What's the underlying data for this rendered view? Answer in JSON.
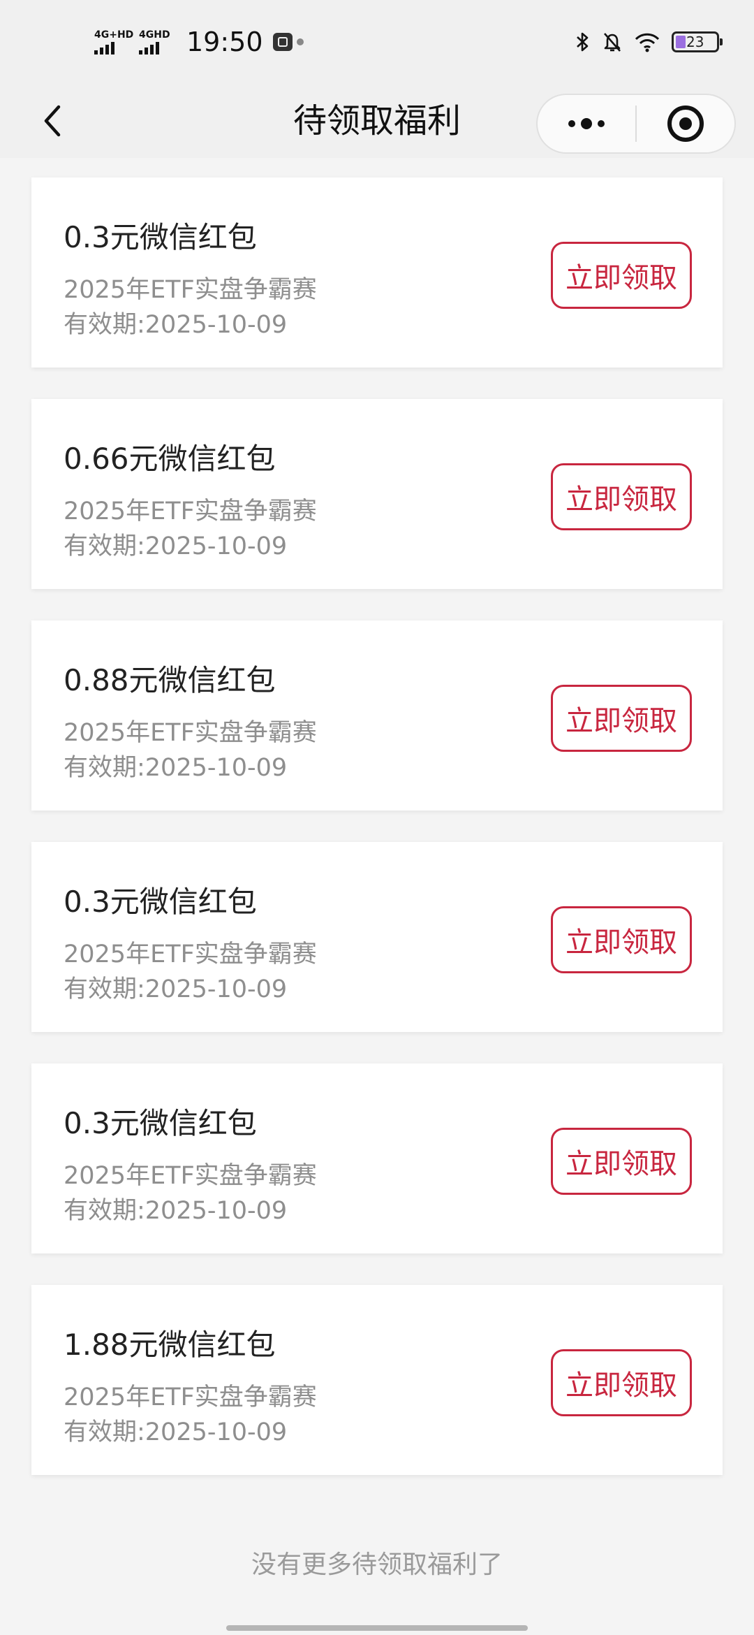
{
  "status_bar": {
    "signal1_tag": "4G+HD",
    "signal2_tag": "4GHD",
    "time": "19:50",
    "battery": "23",
    "icons": [
      "bluetooth-icon",
      "mute-bell-icon",
      "wifi-icon",
      "battery-icon"
    ]
  },
  "nav": {
    "title": "待领取福利",
    "back_icon": "chevron-left-icon",
    "more_icon": "more-dots-icon",
    "close_icon": "target-icon"
  },
  "benefits": [
    {
      "title": "0.3元微信红包",
      "subtitle": "2025年ETF实盘争霸赛",
      "expiry": "有效期:2025-10-09",
      "button": "立即领取"
    },
    {
      "title": "0.66元微信红包",
      "subtitle": "2025年ETF实盘争霸赛",
      "expiry": "有效期:2025-10-09",
      "button": "立即领取"
    },
    {
      "title": "0.88元微信红包",
      "subtitle": "2025年ETF实盘争霸赛",
      "expiry": "有效期:2025-10-09",
      "button": "立即领取"
    },
    {
      "title": "0.3元微信红包",
      "subtitle": "2025年ETF实盘争霸赛",
      "expiry": "有效期:2025-10-09",
      "button": "立即领取"
    },
    {
      "title": "0.3元微信红包",
      "subtitle": "2025年ETF实盘争霸赛",
      "expiry": "有效期:2025-10-09",
      "button": "立即领取"
    },
    {
      "title": "1.88元微信红包",
      "subtitle": "2025年ETF实盘争霸赛",
      "expiry": "有效期:2025-10-09",
      "button": "立即领取"
    }
  ],
  "footer": {
    "no_more": "没有更多待领取福利了"
  },
  "colors": {
    "accent": "#c8263f",
    "background": "#f4f4f4",
    "card": "#ffffff",
    "muted_text": "#8e8e8e"
  }
}
